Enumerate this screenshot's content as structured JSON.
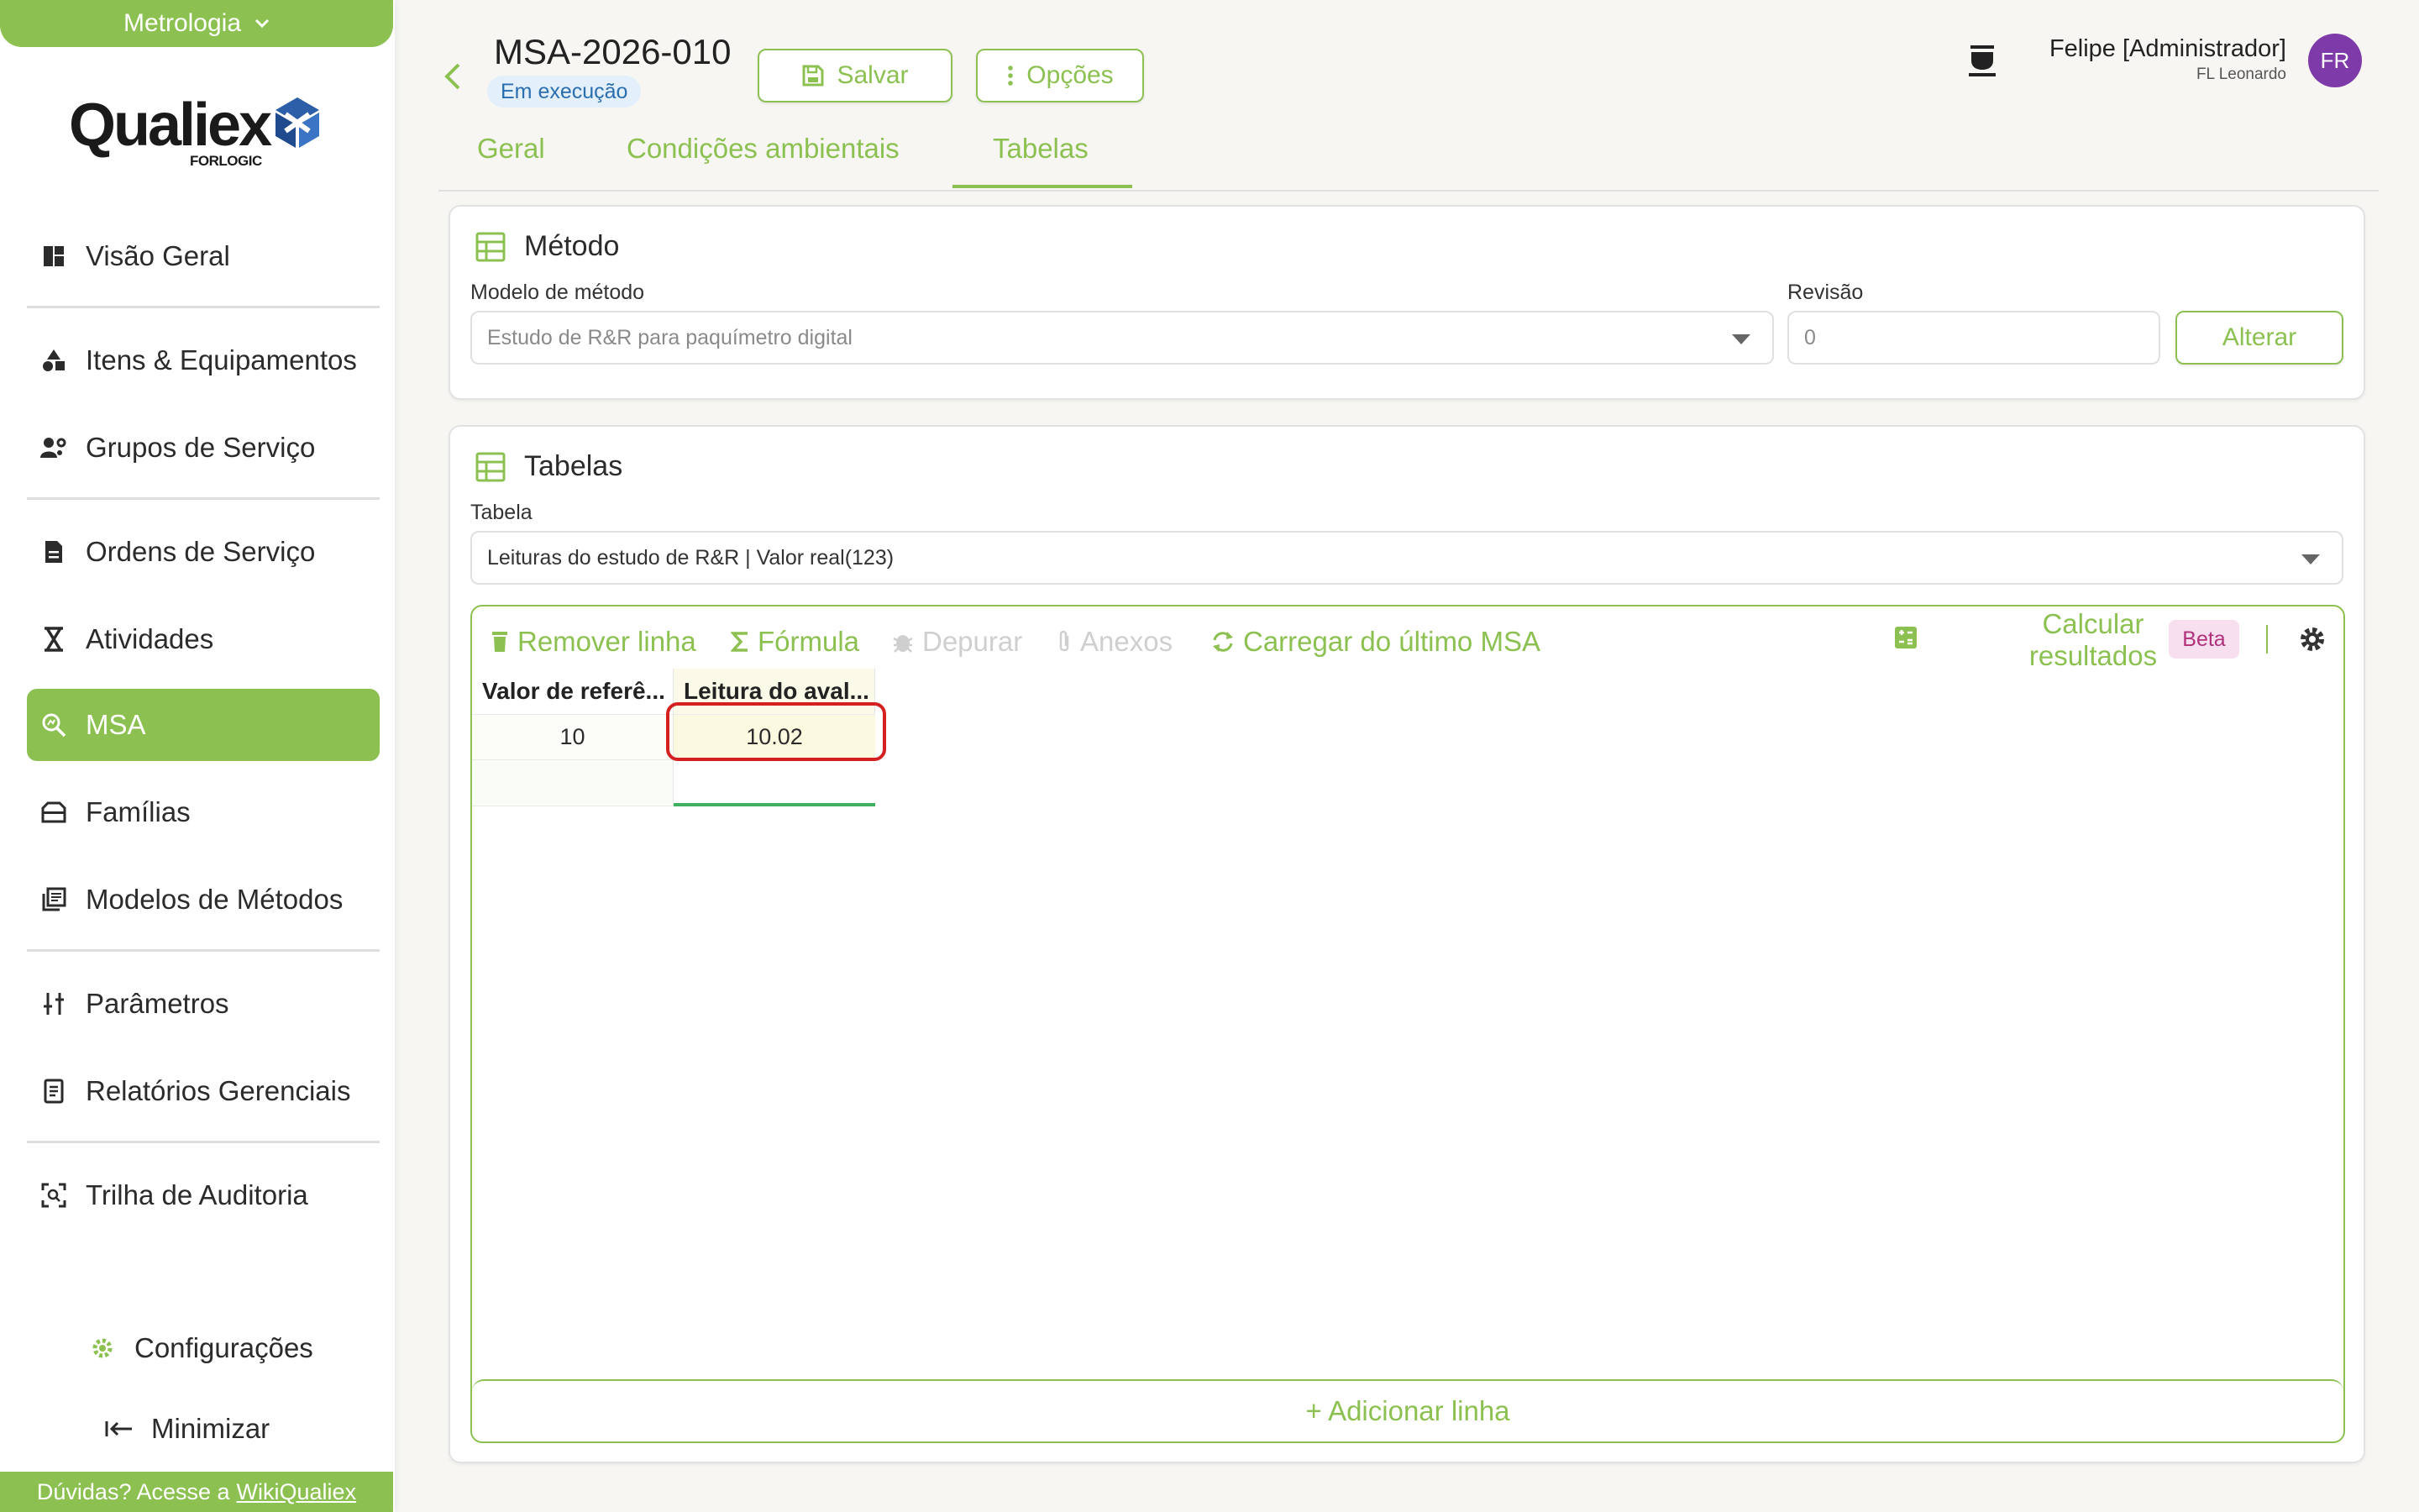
{
  "sidebar": {
    "module": "Metrologia",
    "logo_word": "Qualiex",
    "logo_sub": "FORLOGIC",
    "items": [
      {
        "label": "Visão Geral"
      },
      {
        "label": "Itens & Equipamentos"
      },
      {
        "label": "Grupos de Serviço"
      },
      {
        "label": "Ordens de Serviço"
      },
      {
        "label": "Atividades"
      },
      {
        "label": "MSA"
      },
      {
        "label": "Famílias"
      },
      {
        "label": "Modelos de Métodos"
      },
      {
        "label": "Parâmetros"
      },
      {
        "label": "Relatórios Gerenciais"
      },
      {
        "label": "Trilha de Auditoria"
      }
    ],
    "settings": "Configurações",
    "minimize": "Minimizar",
    "help_prefix": "Dúvidas? Acesse a",
    "help_link": "WikiQualiex"
  },
  "header": {
    "doc_code": "MSA-2026-010",
    "status": "Em execução",
    "save": "Salvar",
    "options": "Opções",
    "user_name": "Felipe [Administrador]",
    "user_org": "FL Leonardo",
    "avatar": "FR"
  },
  "tabs": [
    {
      "label": "Geral"
    },
    {
      "label": "Condições ambientais"
    },
    {
      "label": "Tabelas"
    }
  ],
  "method": {
    "title": "Método",
    "model_label": "Modelo de método",
    "model_value": "Estudo de R&R para paquímetro digital",
    "revision_label": "Revisão",
    "revision_value": "0",
    "change": "Alterar"
  },
  "tables": {
    "title": "Tabelas",
    "table_label": "Tabela",
    "table_value": "Leituras do estudo de R&R | Valor real(123)",
    "toolbar": {
      "remove": "Remover linha",
      "formula": "Fórmula",
      "debug": "Depurar",
      "attachments": "Anexos",
      "load_last": "Carregar do último MSA",
      "calc_line1": "Calcular",
      "calc_line2": "resultados",
      "beta": "Beta"
    },
    "columns": [
      "Valor de referê...",
      "Leitura do aval..."
    ],
    "rows": [
      [
        "10",
        "10.02"
      ],
      [
        "",
        ""
      ]
    ],
    "add_row": "+ Adicionar linha"
  }
}
